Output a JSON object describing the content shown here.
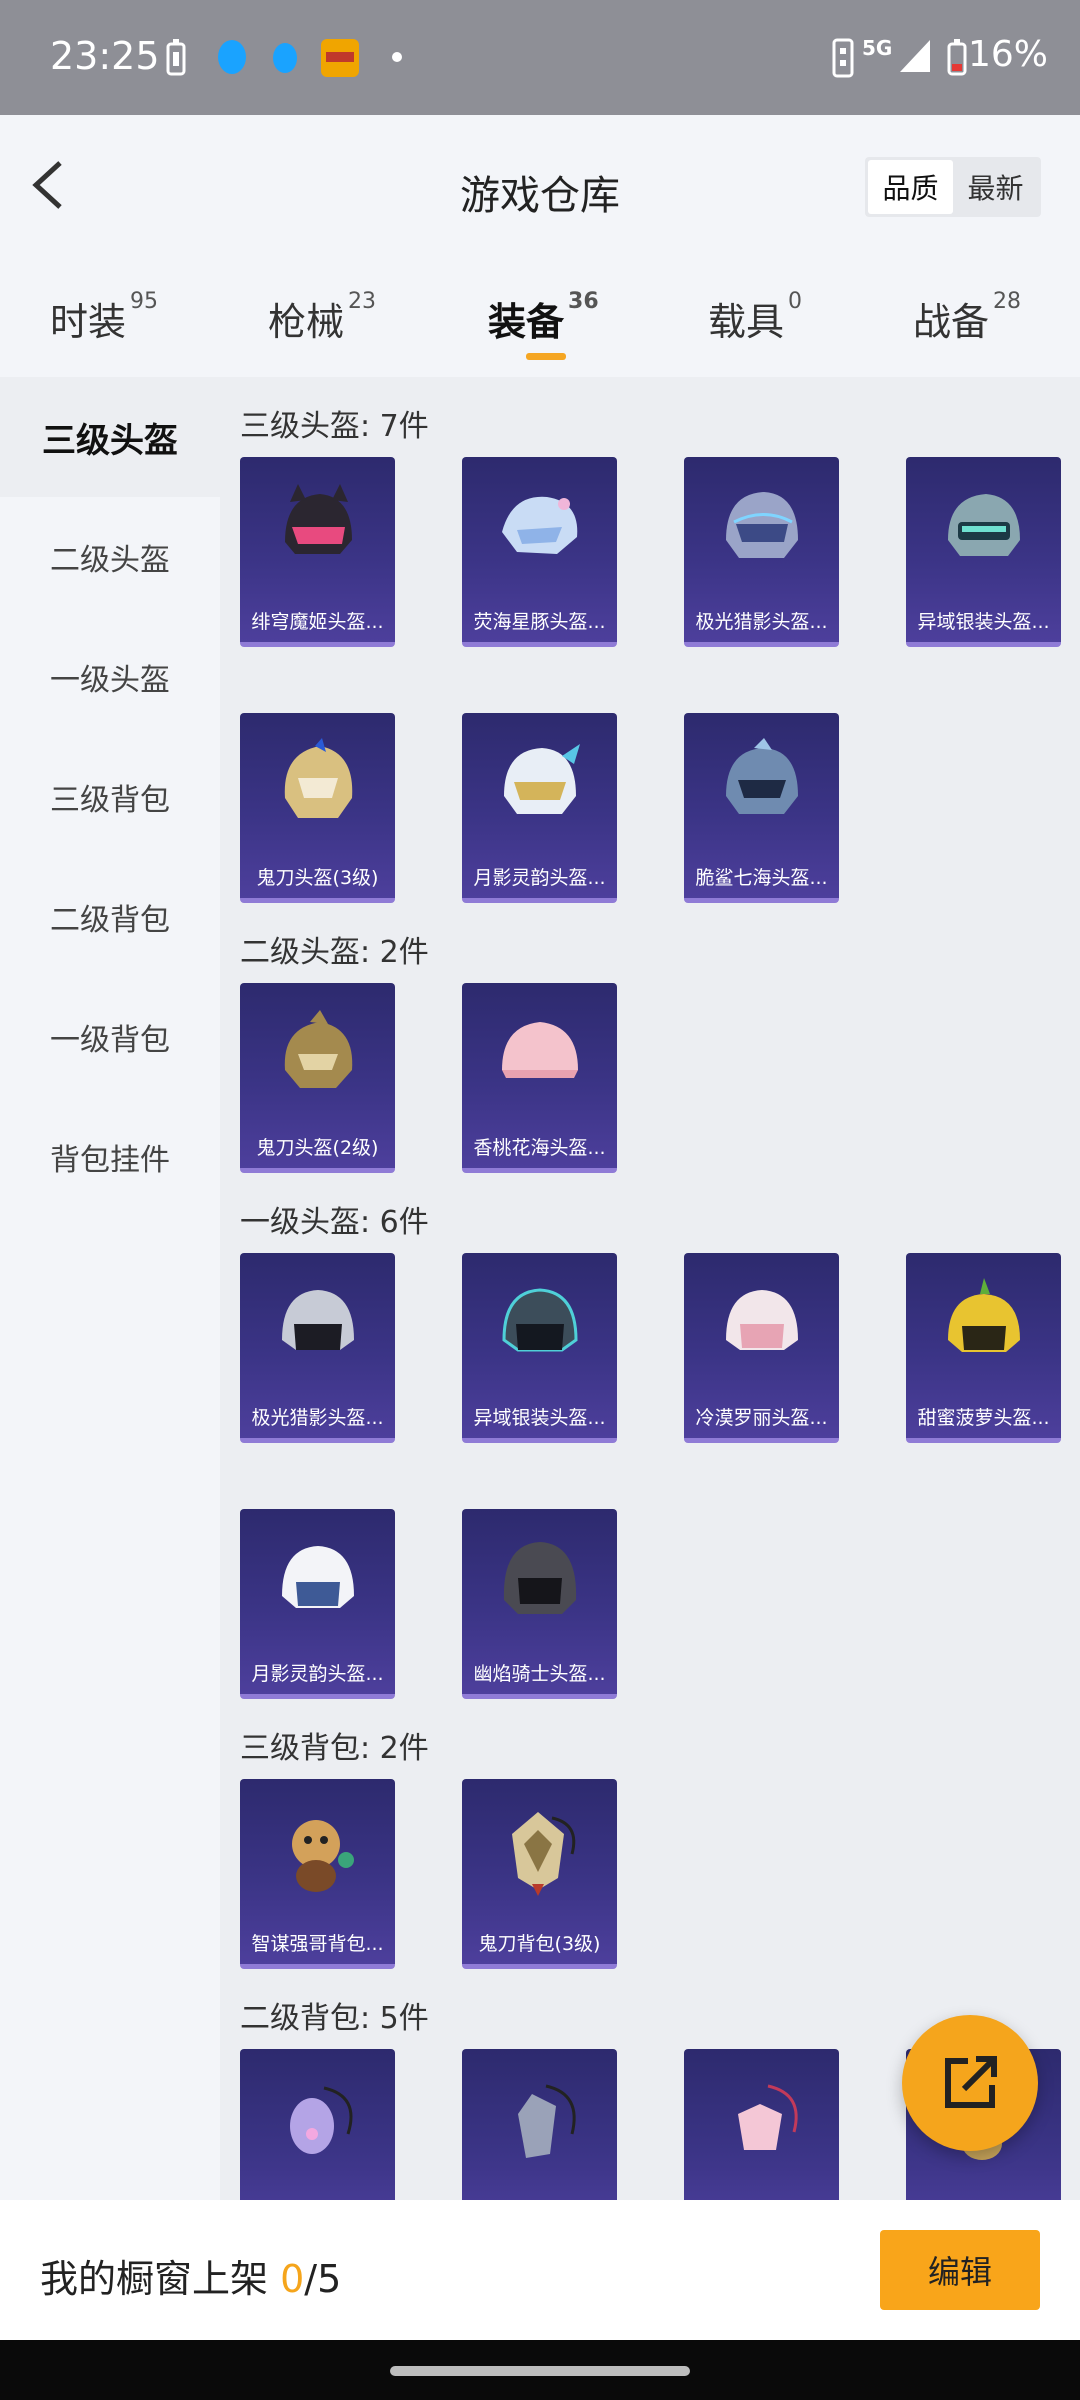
{
  "status_bar": {
    "time": "23:25",
    "network": "5G",
    "battery": "16%"
  },
  "header": {
    "title": "游戏仓库",
    "sort_quality": "品质",
    "sort_newest": "最新"
  },
  "tabs": [
    {
      "label": "时装",
      "count": "95"
    },
    {
      "label": "枪械",
      "count": "23"
    },
    {
      "label": "装备",
      "count": "36"
    },
    {
      "label": "载具",
      "count": "0"
    },
    {
      "label": "战备",
      "count": "28"
    }
  ],
  "sidebar": [
    "三级头盔",
    "二级头盔",
    "一级头盔",
    "三级背包",
    "二级背包",
    "一级背包",
    "背包挂件"
  ],
  "sections": [
    {
      "title": "三级头盔: 7件",
      "items": [
        "绯穹魔姬头盔...",
        "荧海星豚头盔...",
        "极光猎影头盔...",
        "异域银装头盔...",
        "鬼刀头盔(3级)",
        "月影灵韵头盔...",
        "脆鲨七海头盔..."
      ]
    },
    {
      "title": "二级头盔: 2件",
      "items": [
        "鬼刀头盔(2级)",
        "香桃花海头盔..."
      ]
    },
    {
      "title": "一级头盔: 6件",
      "items": [
        "极光猎影头盔...",
        "异域银装头盔...",
        "冷漠罗丽头盔...",
        "甜蜜菠萝头盔...",
        "月影灵韵头盔...",
        "幽焰骑士头盔..."
      ]
    },
    {
      "title": "三级背包: 2件",
      "items": [
        "智谋强哥背包...",
        "鬼刀背包(3级)"
      ]
    },
    {
      "title": "二级背包: 5件",
      "items": [
        "",
        "",
        "",
        ""
      ]
    }
  ],
  "bottom": {
    "label": "我的橱窗上架 ",
    "count": "0",
    "total": "/5",
    "edit": "编辑"
  },
  "colors": {
    "accent": "#f5a51c",
    "card_bg": "#3b3486"
  }
}
